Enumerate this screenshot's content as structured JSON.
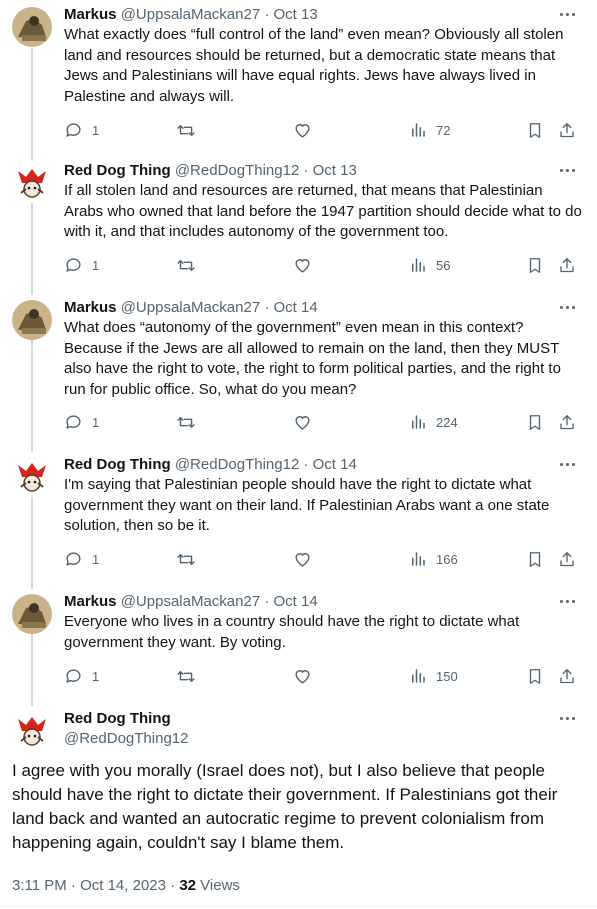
{
  "replies": [
    {
      "author": "markus",
      "name": "Markus",
      "handle": "@UppsalaMackan27",
      "sep": "·",
      "date": "Oct 13",
      "text": "What exactly does “full control of the land” even mean? Obviously all stolen land and resources should be returned, but a democratic state means that Jews and Palestinians will have equal rights. Jews have always lived in Palestine and always will.",
      "replies": "1",
      "views": "72"
    },
    {
      "author": "reddog",
      "name": "Red Dog Thing",
      "handle": "@RedDogThing12",
      "sep": "·",
      "date": "Oct 13",
      "text": "If all stolen land and resources are returned, that means that Palestinian Arabs who owned that land before the 1947 partition should decide what to do with it, and that includes autonomy of the government too.",
      "replies": "1",
      "views": "56"
    },
    {
      "author": "markus",
      "name": "Markus",
      "handle": "@UppsalaMackan27",
      "sep": "·",
      "date": "Oct 14",
      "text": "What does “autonomy of the government” even mean in this context? Because if the Jews are all allowed to remain on the land, then they MUST also have the right to vote, the right to form political parties, and the right to run for public office. So, what do you mean?",
      "replies": "1",
      "views": "224"
    },
    {
      "author": "reddog",
      "name": "Red Dog Thing",
      "handle": "@RedDogThing12",
      "sep": "·",
      "date": "Oct 14",
      "text": "I'm saying that Palestinian people should have the right to dictate what government they want on their land. If Palestinian Arabs want a one state solution, then so be it.",
      "replies": "1",
      "views": "166"
    },
    {
      "author": "markus",
      "name": "Markus",
      "handle": "@UppsalaMackan27",
      "sep": "·",
      "date": "Oct 14",
      "text": "Everyone who lives in a country should have the right to dictate what government they want. By voting.",
      "replies": "1",
      "views": "150"
    }
  ],
  "main": {
    "name": "Red Dog Thing",
    "handle": "@RedDogThing12",
    "text": "I agree with you morally (Israel does not), but I also believe that people should have the right to dictate their government. If Palestinians got their land back and wanted an autocratic regime to prevent colonialism from happening again, couldn't say I blame them.",
    "time": "3:11 PM · Oct 14, 2023 · ",
    "views_count": "32",
    "views_label": " Views"
  },
  "icons": {
    "reply": "reply-icon",
    "retweet": "retweet-icon",
    "like": "heart-icon",
    "views": "analytics-icon",
    "bookmark": "bookmark-icon",
    "share": "share-icon",
    "more": "more-icon"
  },
  "colors": {
    "text": "#0f1419",
    "secondary": "#536471",
    "thread_line": "#cfd9de",
    "avatar_markus_bg": "#c9b48a",
    "avatar_reddog_accent": "#d4241c"
  }
}
